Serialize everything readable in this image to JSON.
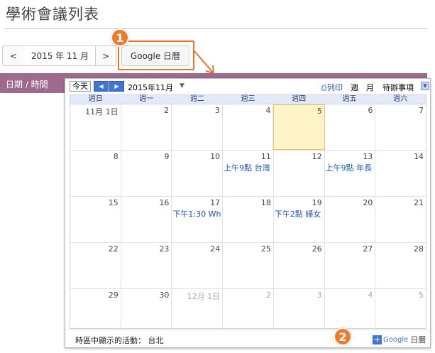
{
  "page": {
    "title": "學術會議列表"
  },
  "nav": {
    "prev": "<",
    "month": "2015 年 11 月",
    "next": ">",
    "google_button": "Google 日曆"
  },
  "badges": {
    "step1": "1",
    "step2": "2"
  },
  "sidebar": {
    "label": "日期 / 時間"
  },
  "calendar": {
    "today_button": "今天",
    "month_title": "2015年11月",
    "print_label": "列印",
    "views": {
      "week": "週",
      "month": "月",
      "agenda": "待辦事項"
    },
    "weekdays": [
      "週日",
      "週一",
      "週二",
      "週三",
      "週四",
      "週五",
      "週六"
    ],
    "weeks": [
      [
        {
          "num": "11月 1日",
          "event": ""
        },
        {
          "num": "2",
          "event": ""
        },
        {
          "num": "3",
          "event": ""
        },
        {
          "num": "4",
          "event": ""
        },
        {
          "num": "5",
          "event": "",
          "today": true
        },
        {
          "num": "6",
          "event": ""
        },
        {
          "num": "7",
          "event": ""
        }
      ],
      [
        {
          "num": "8",
          "event": ""
        },
        {
          "num": "9",
          "event": ""
        },
        {
          "num": "10",
          "event": ""
        },
        {
          "num": "11",
          "event": "上午9點 台灣"
        },
        {
          "num": "12",
          "event": ""
        },
        {
          "num": "13",
          "event": "上午9點 年長"
        },
        {
          "num": "14",
          "event": ""
        }
      ],
      [
        {
          "num": "15",
          "event": ""
        },
        {
          "num": "16",
          "event": ""
        },
        {
          "num": "17",
          "event": "下午1:30 Wh"
        },
        {
          "num": "18",
          "event": ""
        },
        {
          "num": "19",
          "event": "下午2點 婦女"
        },
        {
          "num": "20",
          "event": ""
        },
        {
          "num": "21",
          "event": ""
        }
      ],
      [
        {
          "num": "22",
          "event": ""
        },
        {
          "num": "23",
          "event": ""
        },
        {
          "num": "24",
          "event": ""
        },
        {
          "num": "25",
          "event": ""
        },
        {
          "num": "26",
          "event": ""
        },
        {
          "num": "27",
          "event": ""
        },
        {
          "num": "28",
          "event": ""
        }
      ],
      [
        {
          "num": "29",
          "event": ""
        },
        {
          "num": "30",
          "event": ""
        },
        {
          "num": "12月 1日",
          "event": "",
          "other": true
        },
        {
          "num": "2",
          "event": "",
          "other": true
        },
        {
          "num": "3",
          "event": "",
          "other": true
        },
        {
          "num": "4",
          "event": "",
          "other": true
        },
        {
          "num": "5",
          "event": "",
          "other": true
        }
      ]
    ],
    "timezone": "時區中顯示的活動： 台北",
    "logo": {
      "google": "Google",
      "cal": "日曆"
    }
  }
}
